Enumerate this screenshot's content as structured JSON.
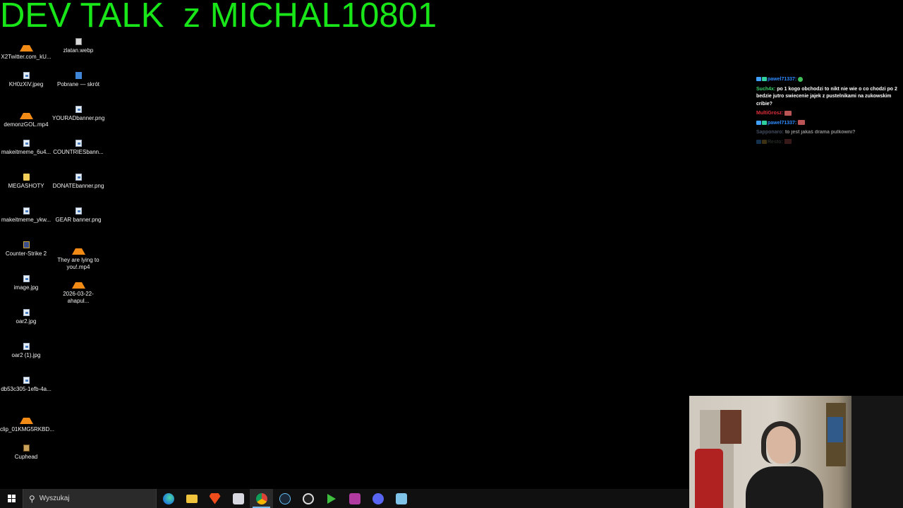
{
  "stream_title": "DEV TALK  z MICHAL10801",
  "desktop": {
    "icons": [
      {
        "label": "X2Twitter.com_kU...",
        "icon": "vlc-icon"
      },
      {
        "label": "zlatan.webp",
        "icon": "image-file-icon"
      },
      {
        "label": "KH0zXiV.jpeg",
        "icon": "image-file-icon"
      },
      {
        "label": "Pobrane — skrót",
        "icon": "shortcut-icon"
      },
      {
        "label": "demonzGOL.mp4",
        "icon": "vlc-icon"
      },
      {
        "label": "YOURADbanner.png",
        "icon": "image-file-icon"
      },
      {
        "label": "makeitmeme_6u4...",
        "icon": "image-file-icon"
      },
      {
        "label": "COUNTRIESbann...",
        "icon": "image-file-icon"
      },
      {
        "label": "MEGASHOTY",
        "icon": "folder-icon"
      },
      {
        "label": "DONATEbanner.png",
        "icon": "image-file-icon"
      },
      {
        "label": "makeitmeme_ykw...",
        "icon": "image-file-icon"
      },
      {
        "label": "GEAR banner.png",
        "icon": "image-file-icon"
      },
      {
        "label": "Counter-Strike 2",
        "icon": "counter-strike-icon"
      },
      {
        "label": "They are lying to you!.mp4",
        "icon": "vlc-icon"
      },
      {
        "label": "image.jpg",
        "icon": "image-file-icon"
      },
      {
        "label": "2026-03-22-ahapul...",
        "icon": "vlc-icon"
      },
      {
        "label": "oar2.jpg",
        "icon": "image-file-icon"
      },
      {
        "label": "oar2 (1).jpg",
        "icon": "image-file-icon"
      },
      {
        "label": "db53c305-1efb-4a...",
        "icon": "image-file-icon"
      },
      {
        "label": "clip_01KMG5RKBD...",
        "icon": "vlc-icon"
      },
      {
        "label": "Cuphead",
        "icon": "cuphead-icon"
      }
    ]
  },
  "chat": {
    "messages": [
      {
        "user": "pawel71337:",
        "text": ""
      },
      {
        "user": "Such4x:",
        "text": "po 1 kogo obchodzi to  nikt nie wie o co chodzi po 2 bedzie jutro swiecenie jajek z pustelnikami na zukowskim cribie?"
      },
      {
        "user": "MultiGrosz:",
        "text": ""
      },
      {
        "user": "pawel71337:",
        "text": ""
      },
      {
        "user": "Sapponaro:",
        "text": "to jest jakaś drama pulkowni?"
      },
      {
        "user": "Resto:",
        "text": ""
      }
    ]
  },
  "taskbar": {
    "search_placeholder": "Wyszukaj",
    "apps": [
      {
        "name": "edge-icon"
      },
      {
        "name": "file-explorer-icon"
      },
      {
        "name": "brave-icon"
      },
      {
        "name": "app-icon"
      },
      {
        "name": "chrome-icon",
        "active": true
      },
      {
        "name": "steam-icon"
      },
      {
        "name": "obs-icon"
      },
      {
        "name": "media-player-icon"
      },
      {
        "name": "vmix-icon"
      },
      {
        "name": "discord-icon"
      },
      {
        "name": "notepad-icon"
      }
    ]
  },
  "colors": {
    "title_green": "#19e619",
    "background": "#000000",
    "taskbar": "#101010"
  }
}
